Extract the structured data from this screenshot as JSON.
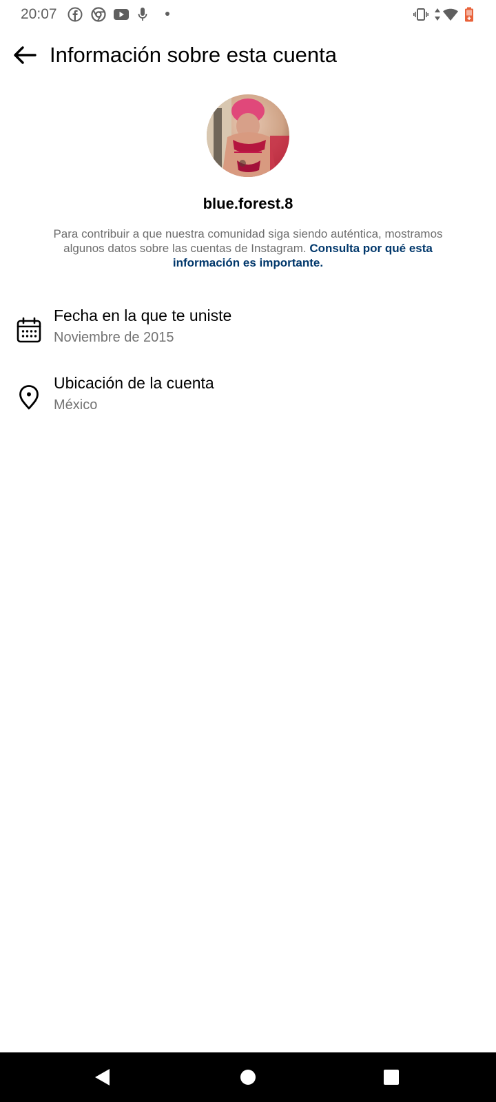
{
  "status_bar": {
    "time": "20:07",
    "left_icons": [
      "facebook-icon",
      "chrome-icon",
      "youtube-icon",
      "microphone-icon",
      "notification-dot"
    ],
    "right_icons": [
      "vibrate-icon",
      "data-arrows-icon",
      "wifi-icon",
      "battery-icon"
    ],
    "battery_color": "#e8623a"
  },
  "header": {
    "back_icon": "arrow-left-icon",
    "title": "Información sobre esta cuenta"
  },
  "profile": {
    "username": "blue.forest.8",
    "description_text": "Para contribuir a que nuestra comunidad siga siendo auténtica, mostramos algunos datos sobre las cuentas de Instagram. ",
    "description_link": "Consulta por qué esta información es importante.",
    "link_color": "#00376b"
  },
  "info": [
    {
      "icon": "calendar-icon",
      "title": "Fecha en la que te uniste",
      "value": "Noviembre de 2015"
    },
    {
      "icon": "location-pin-icon",
      "title": "Ubicación de la cuenta",
      "value": "México"
    }
  ],
  "nav": {
    "icons": [
      "back-triangle-icon",
      "home-circle-icon",
      "recents-square-icon"
    ]
  }
}
